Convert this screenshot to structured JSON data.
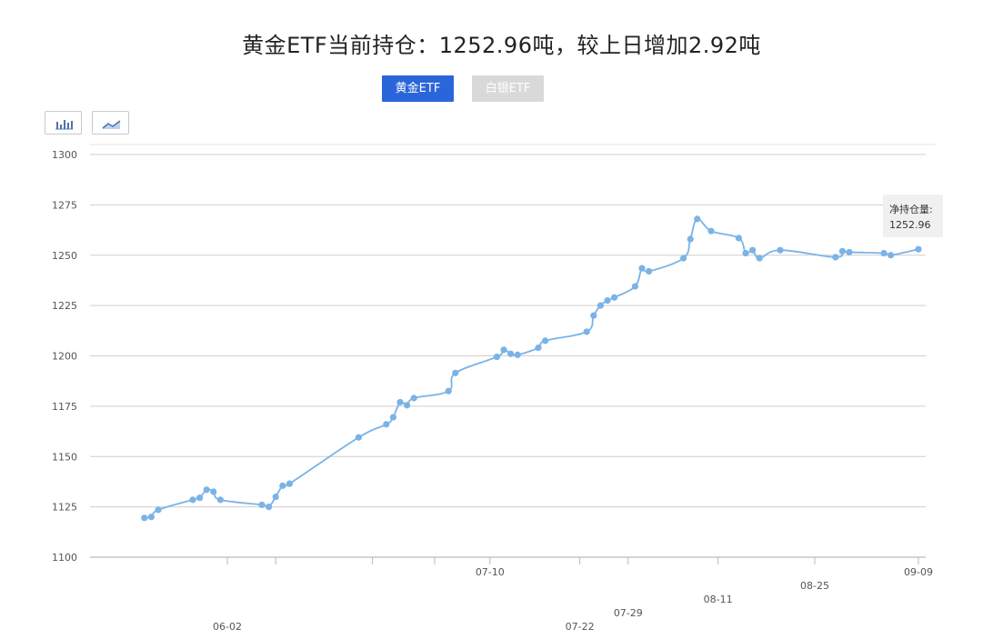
{
  "title": "黄金ETF当前持仓：1252.96吨，较上日增加2.92吨",
  "tabs": [
    {
      "label": "黄金ETF",
      "active": true
    },
    {
      "label": "白银ETF",
      "active": false
    }
  ],
  "chart_type_buttons": [
    {
      "icon": "bar-chart-icon"
    },
    {
      "icon": "line-chart-icon"
    }
  ],
  "colors": {
    "line": "#7ab3e6",
    "active_tab": "#2a66d9",
    "inactive_tab": "#d9d9d9",
    "grid": "#cfcfcf"
  },
  "tooltip": {
    "label": "净持仓量:",
    "value": "1252.96"
  },
  "chart_data": {
    "type": "line",
    "title": "",
    "xlabel": "",
    "ylabel": "",
    "ylim": [
      1100,
      1300
    ],
    "yticks": [
      1100,
      1125,
      1150,
      1175,
      1200,
      1225,
      1250,
      1275,
      1300
    ],
    "grid": true,
    "x_tick_labels": [
      {
        "label": "06-02",
        "at": 6
      },
      {
        "label": "07-10",
        "at": 44
      },
      {
        "label": "07-22",
        "at": 57
      },
      {
        "label": "07-29",
        "at": 64
      },
      {
        "label": "08-11",
        "at": 77
      },
      {
        "label": "08-25",
        "at": 91
      },
      {
        "label": "09-09",
        "at": 106
      }
    ],
    "minor_ticks": [
      6,
      13,
      27,
      36,
      44,
      57,
      64,
      77,
      91,
      106
    ],
    "x_range": [
      -7,
      108
    ],
    "series": [
      {
        "points": [
          {
            "x": -6,
            "y": 1119.5
          },
          {
            "x": -5,
            "y": 1120
          },
          {
            "x": -4,
            "y": 1123.5
          },
          {
            "x": 1,
            "y": 1128.5
          },
          {
            "x": 2,
            "y": 1129.5
          },
          {
            "x": 3,
            "y": 1133.5
          },
          {
            "x": 4,
            "y": 1132.5
          },
          {
            "x": 5,
            "y": 1128.5
          },
          {
            "x": 11,
            "y": 1126
          },
          {
            "x": 12,
            "y": 1125
          },
          {
            "x": 13,
            "y": 1130
          },
          {
            "x": 14,
            "y": 1135.5
          },
          {
            "x": 15,
            "y": 1136.5
          },
          {
            "x": 25,
            "y": 1159.5
          },
          {
            "x": 29,
            "y": 1166
          },
          {
            "x": 30,
            "y": 1169.5
          },
          {
            "x": 31,
            "y": 1177
          },
          {
            "x": 32,
            "y": 1175.5
          },
          {
            "x": 33,
            "y": 1179
          },
          {
            "x": 38,
            "y": 1182.5
          },
          {
            "x": 39,
            "y": 1191.5
          },
          {
            "x": 45,
            "y": 1199.5
          },
          {
            "x": 46,
            "y": 1203
          },
          {
            "x": 47,
            "y": 1201
          },
          {
            "x": 48,
            "y": 1200.5
          },
          {
            "x": 51,
            "y": 1204
          },
          {
            "x": 52,
            "y": 1207.5
          },
          {
            "x": 58,
            "y": 1212
          },
          {
            "x": 59,
            "y": 1220
          },
          {
            "x": 60,
            "y": 1225
          },
          {
            "x": 61,
            "y": 1227.5
          },
          {
            "x": 62,
            "y": 1229
          },
          {
            "x": 65,
            "y": 1234.5
          },
          {
            "x": 66,
            "y": 1243.5
          },
          {
            "x": 67,
            "y": 1242
          },
          {
            "x": 72,
            "y": 1248.5
          },
          {
            "x": 73,
            "y": 1258
          },
          {
            "x": 74,
            "y": 1268
          },
          {
            "x": 76,
            "y": 1262
          },
          {
            "x": 80,
            "y": 1258.5
          },
          {
            "x": 81,
            "y": 1251
          },
          {
            "x": 82,
            "y": 1252.5
          },
          {
            "x": 83,
            "y": 1248.5
          },
          {
            "x": 86,
            "y": 1252.5
          },
          {
            "x": 94,
            "y": 1249
          },
          {
            "x": 95,
            "y": 1252
          },
          {
            "x": 96,
            "y": 1251.5
          },
          {
            "x": 101,
            "y": 1251
          },
          {
            "x": 102,
            "y": 1250
          },
          {
            "x": 106,
            "y": 1252.96
          }
        ]
      }
    ]
  }
}
